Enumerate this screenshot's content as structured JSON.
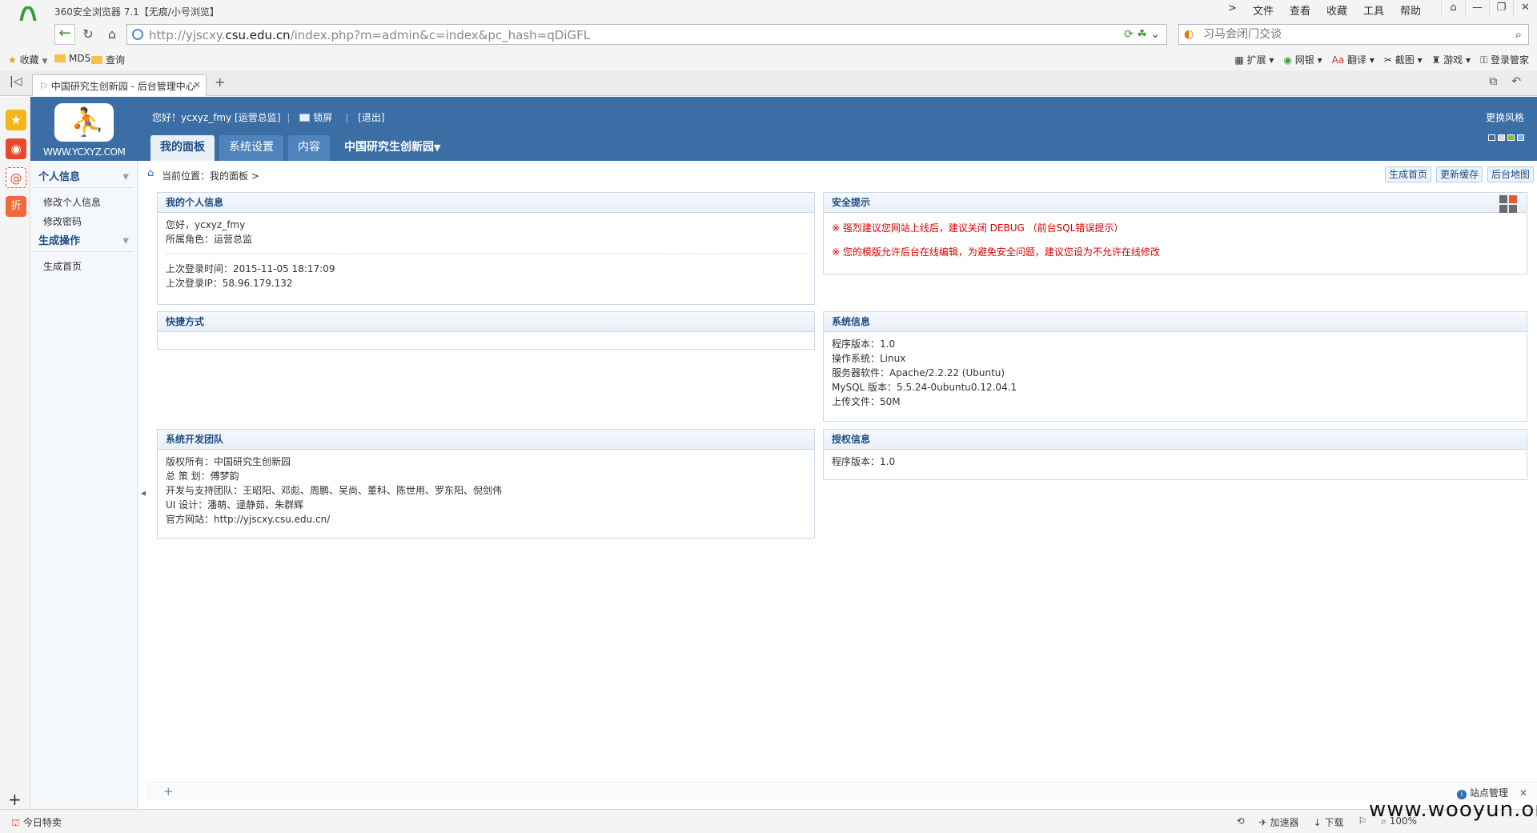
{
  "browser": {
    "title": "360安全浏览器 7.1【无痕/小号浏览】",
    "menu": [
      "文件",
      "查看",
      "收藏",
      "工具",
      "帮助"
    ],
    "url_prefix": "http://yjscxy.",
    "url_domain": "csu.edu.cn",
    "url_rest": "/index.php?m=admin&c=index&pc_hash=qDiGFL",
    "search_placeholder": "习马会闭门交谈",
    "bookmarks": [
      "收藏",
      "MD5",
      "查询"
    ],
    "toolbar_right": [
      "扩展",
      "网银",
      "翻译",
      "截图",
      "游戏",
      "登录管家"
    ],
    "tab_title": "中国研究生创新园 - 后台管理中心",
    "sidebar_badge": "折",
    "status_left": "今日特卖",
    "status_right": [
      "加速器",
      "下载",
      "100%"
    ],
    "watermark": "www.wooyun.org"
  },
  "header": {
    "logo_text": "WWW.YCXYZ.COM",
    "greeting": "您好！ycxyz_fmy [运营总监]",
    "lock": "锁屏",
    "logout": "[退出]",
    "change_style": "更换风格",
    "tabs": [
      "我的面板",
      "系统设置",
      "内容",
      "中国研究生创新园"
    ]
  },
  "sidebar": {
    "group1": "个人信息",
    "group1_items": [
      "修改个人信息",
      "修改密码"
    ],
    "group2": "生成操作",
    "group2_items": [
      "生成首页"
    ]
  },
  "breadcrumb": {
    "text": "当前位置：我的面板 >",
    "buttons": [
      "生成首页",
      "更新缓存",
      "后台地图"
    ]
  },
  "panels": {
    "my_info": {
      "title": "我的个人信息",
      "hello": "您好，ycxyz_fmy",
      "role": "所属角色：运营总监",
      "last_login_time": "上次登录时间：2015-11-05 18:17:09",
      "last_login_ip": "上次登录IP：58.96.179.132"
    },
    "security": {
      "title": "安全提示",
      "line1": "※ 强烈建议您网站上线后，建议关闭 DEBUG （前台SQL错误提示）",
      "line2": "※ 您的模版允许后台在线编辑，为避免安全问题，建议您设为不允许在线修改"
    },
    "shortcuts": {
      "title": "快捷方式"
    },
    "sysinfo": {
      "title": "系统信息",
      "lines": [
        "程序版本：1.0",
        "操作系统：Linux",
        "服务器软件：Apache/2.2.22 (Ubuntu)",
        "MySQL 版本：5.5.24-0ubuntu0.12.04.1",
        "上传文件：50M"
      ]
    },
    "team": {
      "title": "系统开发团队",
      "lines": [
        "版权所有：中国研究生创新园",
        "总 策 划：傅梦韵",
        "开发与支持团队：王昭阳、邓彪、周鹏、吴尚、董科、陈世用、罗东阳、倪剑伟",
        "UI 设计：潘萌、逯静茹、朱群辉",
        "官方网站：http://yjscxy.csu.edu.cn/"
      ]
    },
    "license": {
      "title": "授权信息",
      "lines": [
        "程序版本：1.0"
      ]
    }
  },
  "footer": {
    "site_manage": "站点管理"
  }
}
